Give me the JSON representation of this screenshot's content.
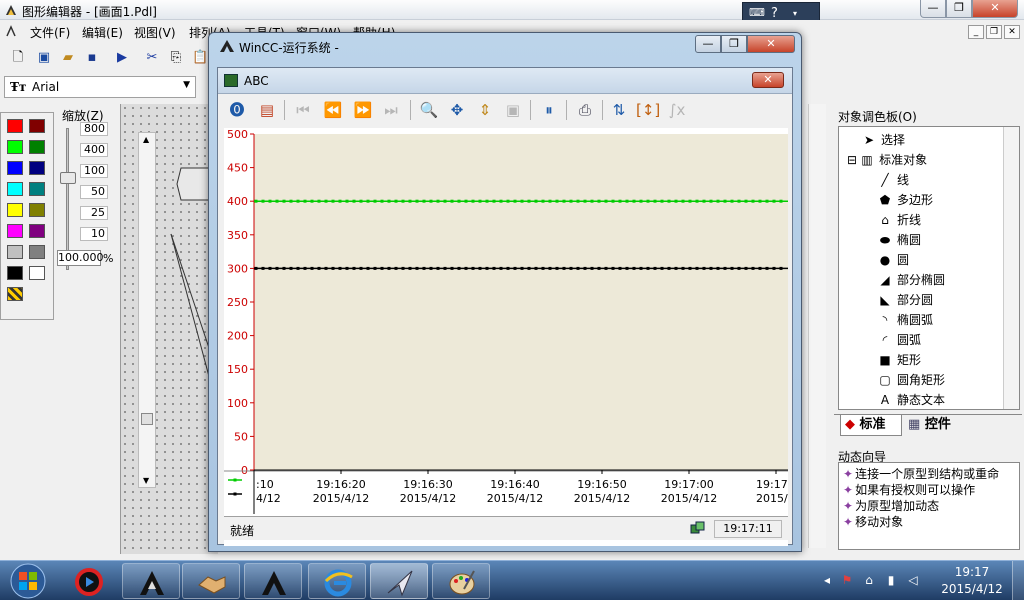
{
  "editor": {
    "title": "图形编辑器 - [画面1.Pdl]",
    "menu": [
      "文件(F)",
      "编辑(E)",
      "视图(V)",
      "排列(A)",
      "工具(T)",
      "窗口(W)",
      "帮助(H)"
    ],
    "font_name": "Arial",
    "zoom_title": "缩放(Z)",
    "zoom_levels": [
      "800",
      "400",
      "100",
      "50",
      "25",
      "10"
    ],
    "zoom_value": "100.000",
    "zoom_unit": "%",
    "zoom_slider_percent": 100,
    "palette_colors": [
      "#ff0000",
      "#800000",
      "#00ff00",
      "#008000",
      "#0000ff",
      "#000080",
      "#00ffff",
      "#008080",
      "#ffff00",
      "#808000",
      "#ff00ff",
      "#800080",
      "#c0c0c0",
      "#808080",
      "#000000",
      "#ffffff"
    ]
  },
  "object_palette": {
    "title": "对象调色板(O)",
    "items": [
      {
        "label": "选择",
        "icon": "cursor-icon"
      },
      {
        "label": "标准对象",
        "icon": "folder-icon"
      },
      {
        "label": "线",
        "icon": "line-icon"
      },
      {
        "label": "多边形",
        "icon": "polygon-icon"
      },
      {
        "label": "折线",
        "icon": "polyline-icon"
      },
      {
        "label": "椭圆",
        "icon": "ellipse-icon"
      },
      {
        "label": "圆",
        "icon": "circle-icon"
      },
      {
        "label": "部分椭圆",
        "icon": "ellipse-segment-icon"
      },
      {
        "label": "部分圆",
        "icon": "circle-segment-icon"
      },
      {
        "label": "椭圆弧",
        "icon": "ellipse-arc-icon"
      },
      {
        "label": "圆弧",
        "icon": "circle-arc-icon"
      },
      {
        "label": "矩形",
        "icon": "rectangle-icon"
      },
      {
        "label": "圆角矩形",
        "icon": "rounded-rectangle-icon"
      },
      {
        "label": "静态文本",
        "icon": "static-text-icon"
      }
    ],
    "tab_standard": "标准",
    "tab_controls": "控件"
  },
  "dynamic_wizard": {
    "title": "动态向导",
    "items": [
      "连接一个原型到结构或重命",
      "如果有授权则可以操作",
      "为原型增加动态",
      "移动对象"
    ]
  },
  "runtime": {
    "title": "WinCC-运行系统 -",
    "trend_title": "ABC",
    "status_text": "就绪",
    "status_time": "19:17:11"
  },
  "chart_data": {
    "type": "line",
    "title": "",
    "xlabel": "",
    "ylabel": "",
    "ylim": [
      0,
      500
    ],
    "y_ticks": [
      500,
      450,
      400,
      350,
      300,
      250,
      200,
      150,
      100,
      50,
      0
    ],
    "x_tick_labels": [
      {
        "time": ":10",
        "date": "4/12"
      },
      {
        "time": "19:16:20",
        "date": "2015/4/12"
      },
      {
        "time": "19:16:30",
        "date": "2015/4/12"
      },
      {
        "time": "19:16:40",
        "date": "2015/4/12"
      },
      {
        "time": "19:16:50",
        "date": "2015/4/12"
      },
      {
        "time": "19:17:00",
        "date": "2015/4/12"
      },
      {
        "time": "19:17",
        "date": "2015/4"
      }
    ],
    "x_range": [
      "19:16:10",
      "19:17:10"
    ],
    "series": [
      {
        "color": "#00cc00",
        "values": [
          400,
          400
        ]
      },
      {
        "color": "#000000",
        "values": [
          300,
          300
        ]
      }
    ],
    "background": "#ede9d8",
    "axis_color": "#cc0000",
    "grid": false
  },
  "taskbar": {
    "clock_time": "19:17",
    "clock_date": "2015/4/12"
  }
}
